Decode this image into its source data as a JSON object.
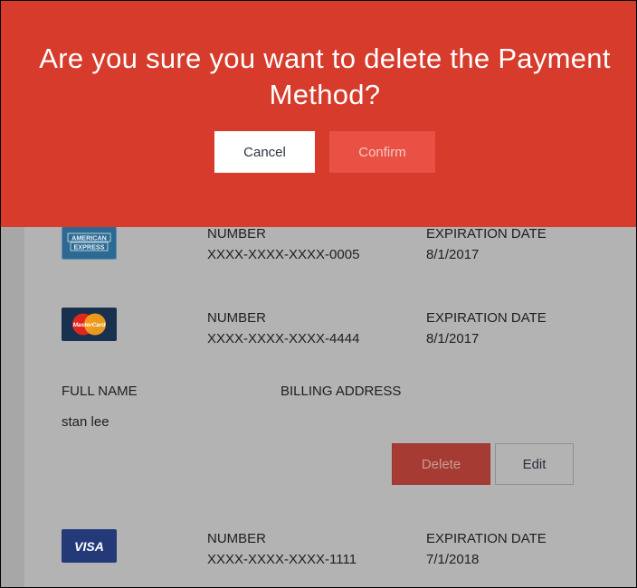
{
  "modal": {
    "title": "Are you sure you want to delete the Payment Method?",
    "cancel_label": "Cancel",
    "confirm_label": "Confirm"
  },
  "cards": [
    {
      "logo_text_line1": "AMERICAN",
      "logo_text_line2": "EXPRESS",
      "number_label": "NUMBER",
      "number": "XXXX-XXXX-XXXX-0005",
      "exp_label": "EXPIRATION DATE",
      "exp": "8/1/2017"
    },
    {
      "logo_text": "MasterCard",
      "number_label": "NUMBER",
      "number": "XXXX-XXXX-XXXX-4444",
      "exp_label": "EXPIRATION DATE",
      "exp": "8/1/2017"
    },
    {
      "logo_text": "VISA",
      "number_label": "NUMBER",
      "number": "XXXX-XXXX-XXXX-1111",
      "exp_label": "EXPIRATION DATE",
      "exp": "7/1/2018"
    }
  ],
  "details": {
    "full_name_label": "FULL NAME",
    "full_name": "stan lee",
    "billing_address_label": "BILLING ADDRESS",
    "delete_label": "Delete",
    "edit_label": "Edit"
  },
  "colors": {
    "modal_bg": "#d63b2b",
    "confirm_bg": "#e85144",
    "overlay_bg": "#b3b3b3",
    "delete_bg": "#a63b33"
  }
}
